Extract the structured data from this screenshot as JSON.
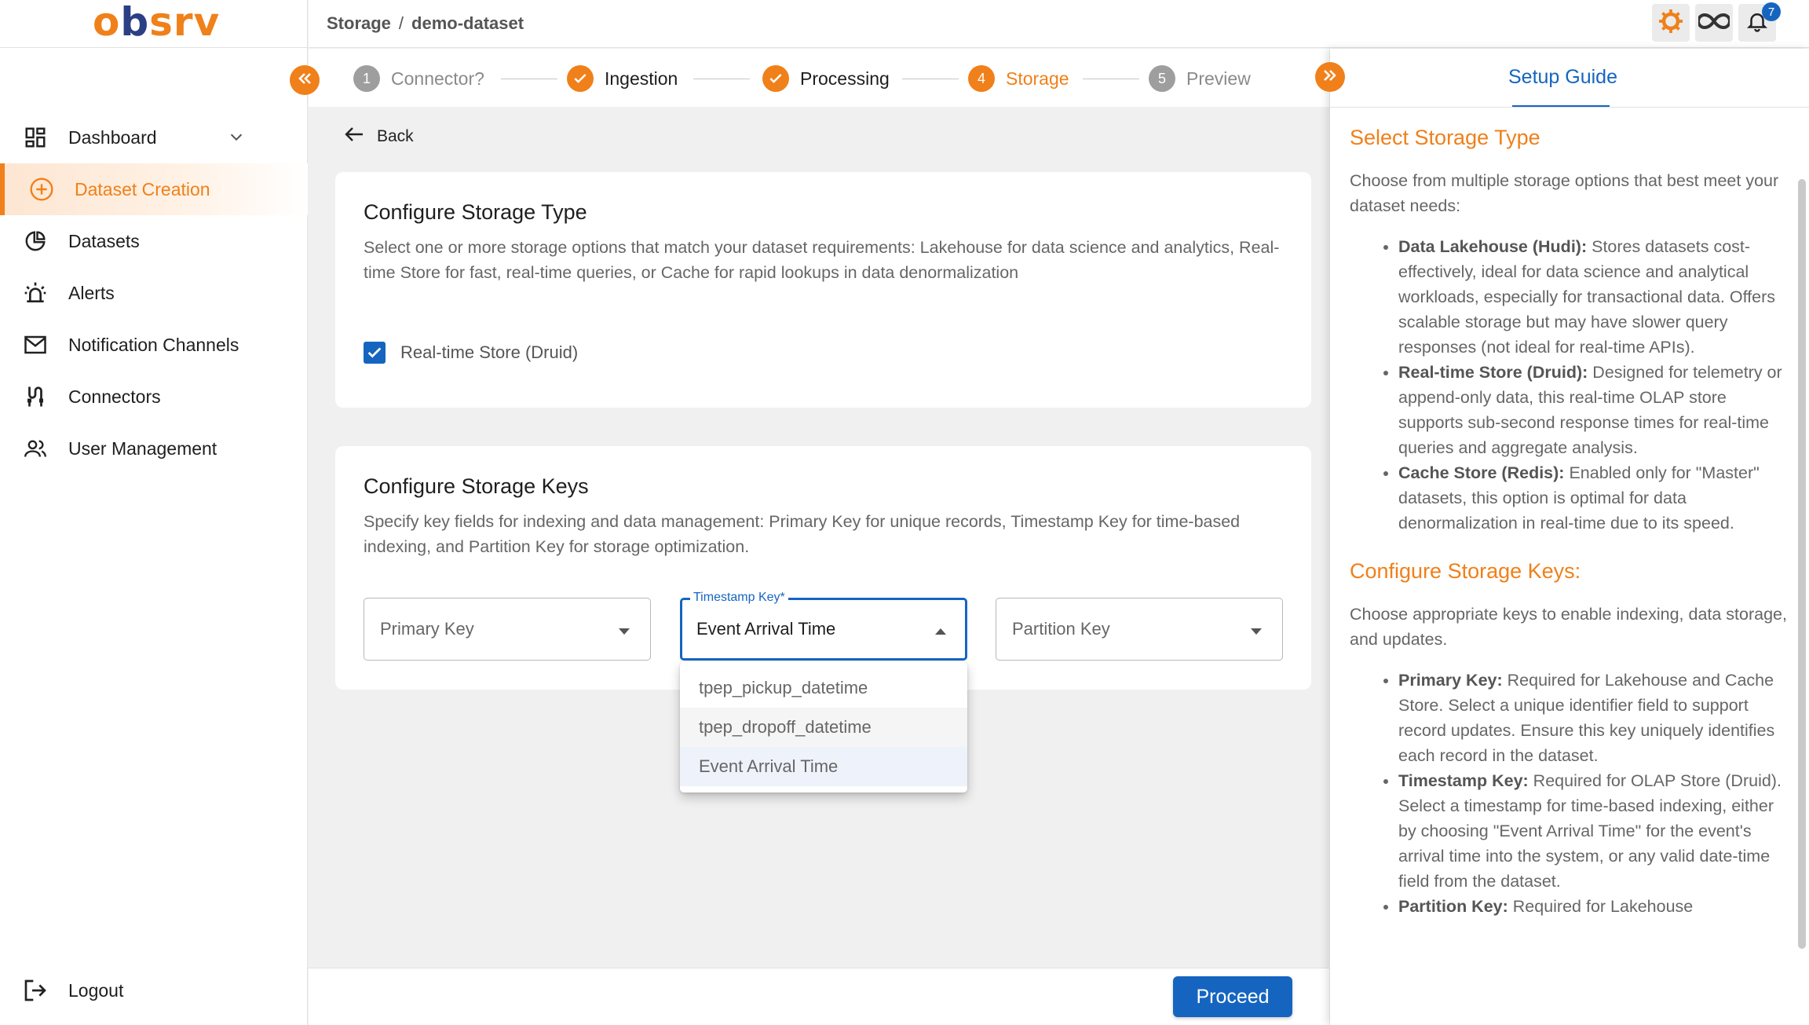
{
  "logo": {
    "letters": [
      "o",
      "b",
      "s",
      "r",
      "v"
    ]
  },
  "breadcrumb": {
    "parent": "Storage",
    "separator": "/",
    "current": "demo-dataset"
  },
  "header": {
    "notification_count": "7"
  },
  "sidebar": {
    "items": [
      {
        "label": "Dashboard",
        "icon": "dashboard-icon"
      },
      {
        "label": "Dataset Creation",
        "icon": "add-circle-icon"
      },
      {
        "label": "Datasets",
        "icon": "datasets-icon"
      },
      {
        "label": "Alerts",
        "icon": "alarm-icon"
      },
      {
        "label": "Notification Channels",
        "icon": "mail-icon"
      },
      {
        "label": "Connectors",
        "icon": "connectors-icon"
      },
      {
        "label": "User Management",
        "icon": "users-icon"
      }
    ],
    "logout": "Logout"
  },
  "stepper": {
    "steps": [
      {
        "num": "1",
        "label": "Connector?",
        "state": "pending"
      },
      {
        "num": "2",
        "label": "Ingestion",
        "state": "done"
      },
      {
        "num": "3",
        "label": "Processing",
        "state": "done"
      },
      {
        "num": "4",
        "label": "Storage",
        "state": "active"
      },
      {
        "num": "5",
        "label": "Preview",
        "state": "pending"
      }
    ]
  },
  "back_label": "Back",
  "storage_type": {
    "title": "Configure Storage Type",
    "description": "Select one or more storage options that match your dataset requirements: Lakehouse for data science and analytics, Real-time Store for fast, real-time queries, or Cache for rapid lookups in data denormalization",
    "option_label": "Real-time Store (Druid)",
    "option_checked": true
  },
  "storage_keys": {
    "title": "Configure Storage Keys",
    "description": "Specify key fields for indexing and data management: Primary Key for unique records, Timestamp Key for time-based indexing, and Partition Key for storage optimization.",
    "primary_placeholder": "Primary Key",
    "timestamp_label": "Timestamp Key*",
    "timestamp_value": "Event Arrival Time",
    "partition_placeholder": "Partition Key",
    "dropdown_options": [
      "tpep_pickup_datetime",
      "tpep_dropoff_datetime",
      "Event Arrival Time"
    ]
  },
  "proceed_label": "Proceed",
  "guide": {
    "tab": "Setup Guide",
    "section1_title": "Select Storage Type",
    "section1_intro": "Choose from multiple storage options that best meet your dataset needs:",
    "section1_items": [
      {
        "term": "Data Lakehouse (Hudi):",
        "text": " Stores datasets cost-effectively, ideal for data science and analytical workloads, especially for transactional data. Offers scalable storage but may have slower query responses (not ideal for real-time APIs)."
      },
      {
        "term": "Real-time Store (Druid):",
        "text": " Designed for telemetry or append-only data, this real-time OLAP store supports sub-second response times for real-time queries and aggregate analysis."
      },
      {
        "term": "Cache Store (Redis):",
        "text": " Enabled only for \"Master\" datasets, this option is optimal for data denormalization in real-time due to its speed."
      }
    ],
    "section2_title": "Configure Storage Keys:",
    "section2_intro": "Choose appropriate keys to enable indexing, data storage, and updates.",
    "section2_items": [
      {
        "term": "Primary Key:",
        "text": " Required for Lakehouse and Cache Store. Select a unique identifier field to support record updates. Ensure this key uniquely identifies each record in the dataset."
      },
      {
        "term": "Timestamp Key:",
        "text": " Required for OLAP Store (Druid). Select a timestamp for time-based indexing, either by choosing \"Event Arrival Time\" for the event's arrival time into the system, or any valid date-time field from the dataset."
      },
      {
        "term": "Partition Key:",
        "text": " Required for Lakehouse"
      }
    ]
  },
  "colors": {
    "accent": "#f08019",
    "primary": "#1565c0",
    "brand_dark": "#2a3f84"
  }
}
